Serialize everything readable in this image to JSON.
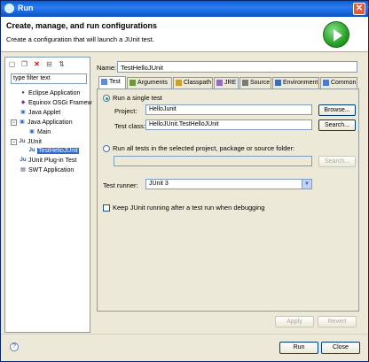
{
  "window": {
    "title": "Run",
    "close_glyph": "✕"
  },
  "banner": {
    "heading": "Create, manage, and run configurations",
    "subtitle": "Create a configuration that will launch a JUnit test."
  },
  "left": {
    "toolbar_icons": [
      "new-config-icon",
      "duplicate-icon",
      "delete-icon",
      "collapse-all-icon",
      "filter-icon"
    ],
    "filter_value": "type filter text",
    "tree": [
      {
        "label": "Eclipse Application",
        "icon": "eclipse-app-icon",
        "level": 1
      },
      {
        "label": "Equinox OSGi Framew",
        "icon": "osgi-icon",
        "level": 1
      },
      {
        "label": "Java Applet",
        "icon": "applet-icon",
        "level": 1
      },
      {
        "label": "Java Application",
        "icon": "java-app-icon",
        "level": 1,
        "expanded": true
      },
      {
        "label": "Main",
        "icon": "java-app-icon",
        "level": 2
      },
      {
        "label": "JUnit",
        "icon": "junit-icon",
        "level": 1,
        "expanded": true
      },
      {
        "label": "TestHelloJUnit",
        "icon": "junit-icon",
        "level": 2,
        "selected": true
      },
      {
        "label": "JUnit Plug-in Test",
        "icon": "junit-plugin-icon",
        "level": 1
      },
      {
        "label": "SWT Application",
        "icon": "swt-icon",
        "level": 1
      }
    ]
  },
  "config": {
    "name_label": "Name:",
    "name_value": "TestHelloJUnit",
    "tabs": [
      {
        "label": "Test",
        "icon": "junit-icon",
        "active": true
      },
      {
        "label": "Arguments",
        "icon": "arguments-icon"
      },
      {
        "label": "Classpath",
        "icon": "classpath-icon"
      },
      {
        "label": "JRE",
        "icon": "jre-icon"
      },
      {
        "label": "Source",
        "icon": "source-icon"
      },
      {
        "label": "Environment",
        "icon": "environment-icon"
      },
      {
        "label": "Common",
        "icon": "common-icon"
      }
    ],
    "run_single_label": "Run a single test",
    "project_label": "Project:",
    "project_value": "HelloJunit",
    "browse_label": "Browse...",
    "test_class_label": "Test class:",
    "test_class_value": "HelloJUnit.TestHelloJUnit",
    "search_label": "Search...",
    "run_all_label": "Run all tests in the selected project, package or source folder:",
    "search2_label": "Search...",
    "runner_label": "Test runner:",
    "runner_value": "JUnit 3",
    "keep_running_label": "Keep JUnit running after a test run when debugging",
    "apply_label": "Apply",
    "revert_label": "Revert"
  },
  "footer": {
    "help_glyph": "?",
    "run_label": "Run",
    "close_label": "Close"
  },
  "colors": {
    "selection": "#316ac5",
    "titlebar": "#0a5fd6",
    "dialog_bg": "#ece9d8"
  }
}
